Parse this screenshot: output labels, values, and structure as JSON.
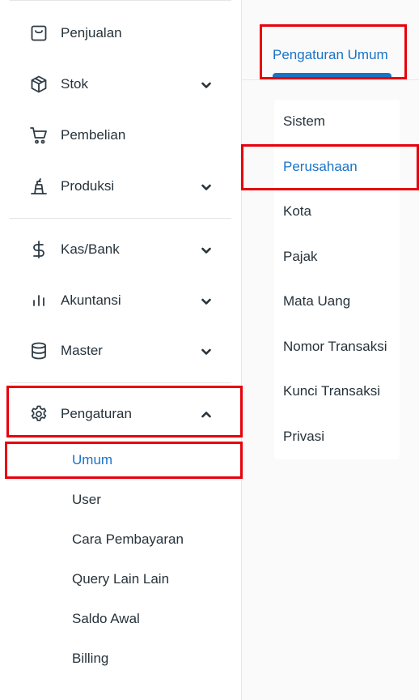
{
  "sidebar": {
    "items": [
      {
        "label": "Penjualan",
        "icon": "bag-icon",
        "expandable": false
      },
      {
        "label": "Stok",
        "icon": "box-icon",
        "expandable": true
      },
      {
        "label": "Pembelian",
        "icon": "cart-icon",
        "expandable": false
      },
      {
        "label": "Produksi",
        "icon": "production-icon",
        "expandable": true
      },
      {
        "label": "Kas/Bank",
        "icon": "dollar-icon",
        "expandable": true
      },
      {
        "label": "Akuntansi",
        "icon": "bar-chart-icon",
        "expandable": true
      },
      {
        "label": "Master",
        "icon": "database-icon",
        "expandable": true
      },
      {
        "label": "Pengaturan",
        "icon": "gear-icon",
        "expandable": true,
        "expanded": true
      }
    ],
    "pengaturan_submenu": [
      "Umum",
      "User",
      "Cara Pembayaran",
      "Query Lain Lain",
      "Saldo Awal",
      "Billing"
    ],
    "active_submenu": "Umum"
  },
  "right_panel": {
    "tab_label": "Pengaturan Umum",
    "submenu": [
      "Sistem",
      "Perusahaan",
      "Kota",
      "Pajak",
      "Mata Uang",
      "Nomor Transaksi",
      "Kunci Transaksi",
      "Privasi"
    ],
    "active_item": "Perusahaan"
  },
  "colors": {
    "accent": "#1a73c7",
    "highlight": "#e8000b",
    "text": "#26323a"
  }
}
